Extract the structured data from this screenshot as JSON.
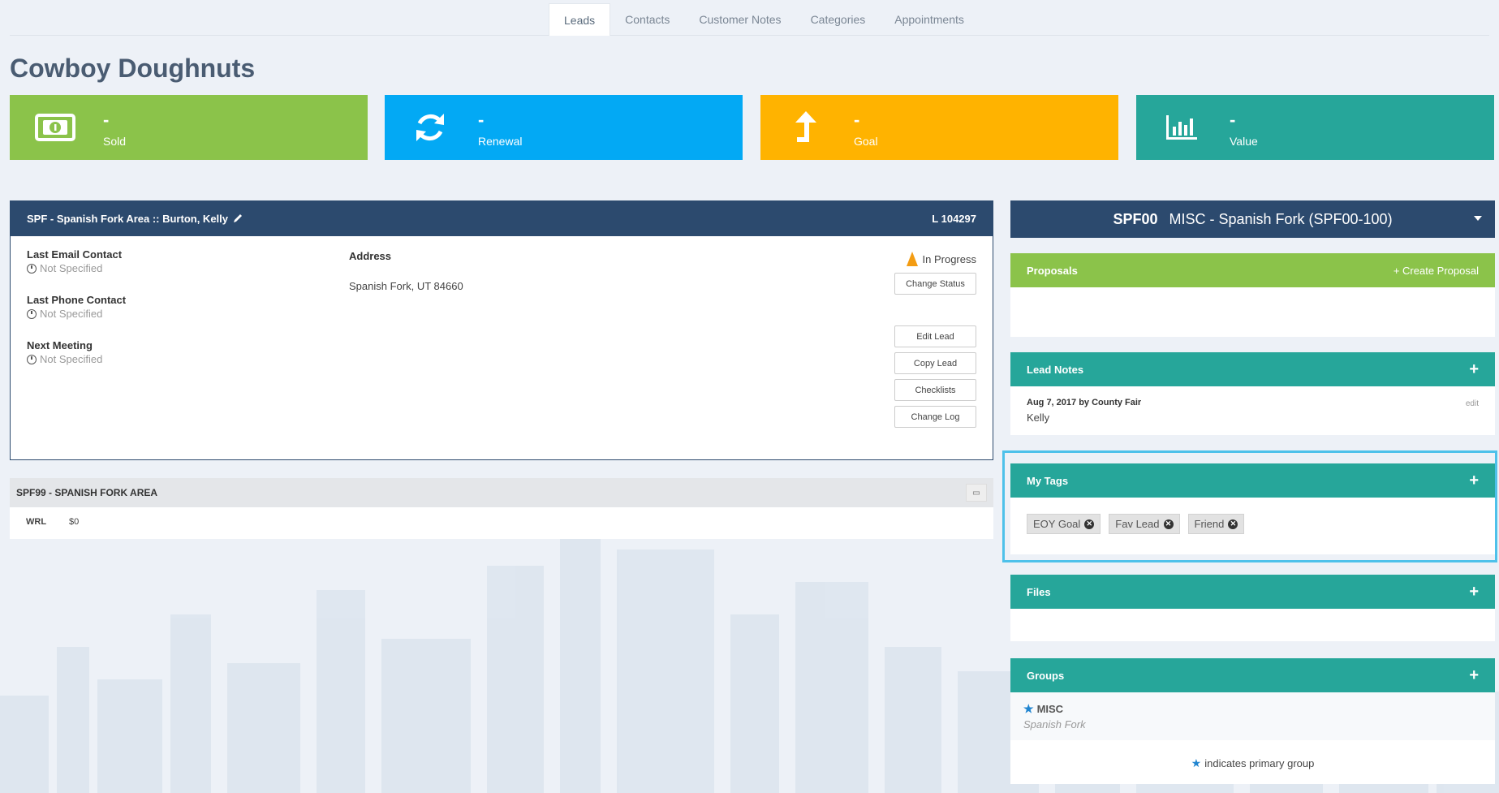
{
  "tabs": [
    {
      "label": "Leads",
      "active": true
    },
    {
      "label": "Contacts"
    },
    {
      "label": "Customer Notes"
    },
    {
      "label": "Categories"
    },
    {
      "label": "Appointments"
    }
  ],
  "page_title": "Cowboy Doughnuts",
  "stats": [
    {
      "value": "-",
      "label": "Sold",
      "icon": "money-icon",
      "color": "#8bc34a"
    },
    {
      "value": "-",
      "label": "Renewal",
      "icon": "refresh-icon",
      "color": "#03a9f4"
    },
    {
      "value": "-",
      "label": "Goal",
      "icon": "arrow-up-icon",
      "color": "#ffb300"
    },
    {
      "value": "-",
      "label": "Value",
      "icon": "bar-chart-icon",
      "color": "#26a69a"
    }
  ],
  "lead": {
    "header_title": "SPF - Spanish Fork Area :: Burton, Kelly",
    "lead_id": "L 104297",
    "last_email_label": "Last Email Contact",
    "last_email_value": "Not Specified",
    "last_phone_label": "Last Phone Contact",
    "last_phone_value": "Not Specified",
    "next_meeting_label": "Next Meeting",
    "next_meeting_value": "Not Specified",
    "address_label": "Address",
    "address_value": "Spanish Fork, UT 84660",
    "status": "In Progress",
    "buttons": {
      "change_status": "Change Status",
      "edit_lead": "Edit Lead",
      "copy_lead": "Copy Lead",
      "checklists": "Checklists",
      "change_log": "Change Log"
    }
  },
  "area": {
    "title": "SPF99 - SPANISH FORK AREA",
    "label": "WRL",
    "value": "$0"
  },
  "branch": {
    "code": "SPF00",
    "name": "MISC - Spanish Fork (SPF00-100)"
  },
  "proposals": {
    "title": "Proposals",
    "create_label": "Create Proposal"
  },
  "lead_notes": {
    "title": "Lead Notes",
    "meta": "Aug 7, 2017 by County Fair",
    "text": "Kelly",
    "edit_label": "edit"
  },
  "my_tags": {
    "title": "My Tags",
    "tags": [
      "EOY Goal",
      "Fav Lead",
      "Friend"
    ]
  },
  "files": {
    "title": "Files"
  },
  "groups": {
    "title": "Groups",
    "group_name": "MISC",
    "group_sub": "Spanish Fork",
    "legend": "indicates primary group"
  }
}
